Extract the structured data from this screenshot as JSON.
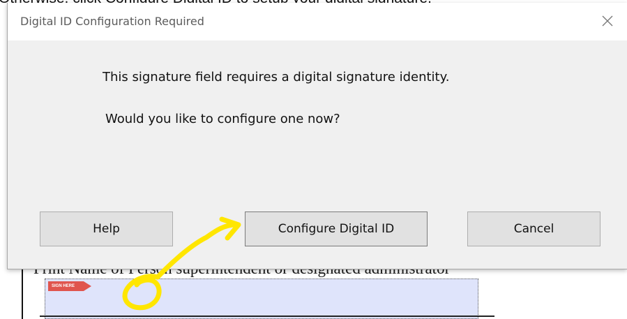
{
  "background": {
    "instruction_text": "Otherwise, click Configure Digital ID to setup your digital signature.",
    "pdf_field_label": "Print Name of Person superintendent or designated administrator",
    "sign_here_tag": "SIGN HERE"
  },
  "dialog": {
    "title": "Digital ID Configuration Required",
    "message_primary": "This signature field requires a digital signature identity.",
    "message_secondary": "Would you like to configure one now?",
    "buttons": {
      "help": "Help",
      "configure": "Configure Digital ID",
      "cancel": "Cancel"
    }
  },
  "icons": {
    "close": "close-icon"
  },
  "colors": {
    "dialog_background": "#f0f0f0",
    "titlebar_background": "#ffffff",
    "button_background": "#e1e1e1",
    "annotation_yellow": "#ffe600",
    "signature_field_fill": "#dfe4fb",
    "sign_here_tag": "#e0554e"
  }
}
